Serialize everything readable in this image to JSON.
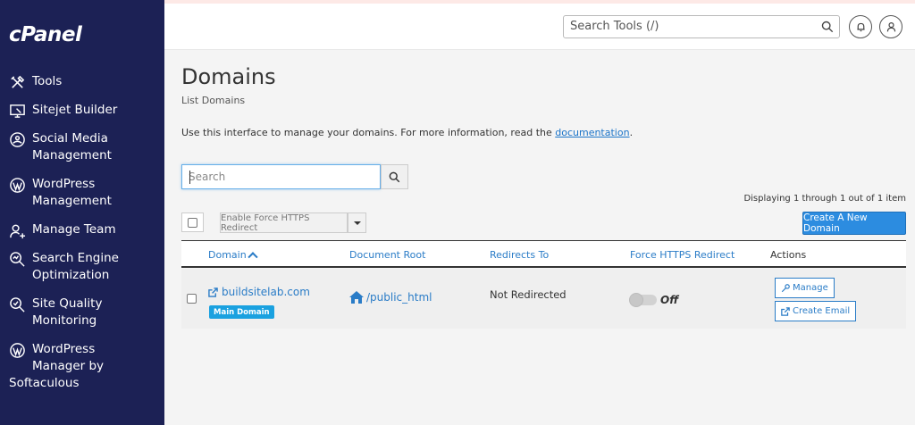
{
  "sidebar": {
    "logo": "cPanel",
    "items": [
      {
        "label": "Tools"
      },
      {
        "label": "Sitejet Builder"
      },
      {
        "label": "Social Media",
        "label2": "Management"
      },
      {
        "label": "WordPress",
        "label2": "Management"
      },
      {
        "label": "Manage Team"
      },
      {
        "label": "Search Engine",
        "label2": "Optimization"
      },
      {
        "label": "Site Quality",
        "label2": "Monitoring"
      },
      {
        "label": "WordPress",
        "label2": "Manager by",
        "label3": "Softaculous"
      }
    ]
  },
  "topbar": {
    "search_placeholder": "Search Tools (/)"
  },
  "main": {
    "title": "Domains",
    "subtitle": "List Domains",
    "description_prefix": "Use this interface to manage your domains. For more information, read the ",
    "description_link": "documentation",
    "description_suffix": ".",
    "search_placeholder": "Search",
    "displaying": "Displaying 1 through 1 out of 1 item",
    "force_https_button": "Enable Force HTTPS Redirect",
    "create_button": "Create A New Domain"
  },
  "table": {
    "headers": {
      "domain": "Domain",
      "document_root": "Document Root",
      "redirects_to": "Redirects To",
      "force_https": "Force HTTPS Redirect",
      "actions": "Actions"
    },
    "rows": [
      {
        "domain": "buildsitelab.com",
        "badge": "Main Domain",
        "document_root": "/public_html",
        "redirects_to": "Not Redirected",
        "force_https": "Off",
        "manage": "Manage",
        "create_email": "Create Email"
      }
    ]
  },
  "colors": {
    "sidebar_bg": "#1c2155",
    "link": "#2a7cc7",
    "primary_button": "#2c8ce0",
    "badge": "#1aa1e0"
  }
}
